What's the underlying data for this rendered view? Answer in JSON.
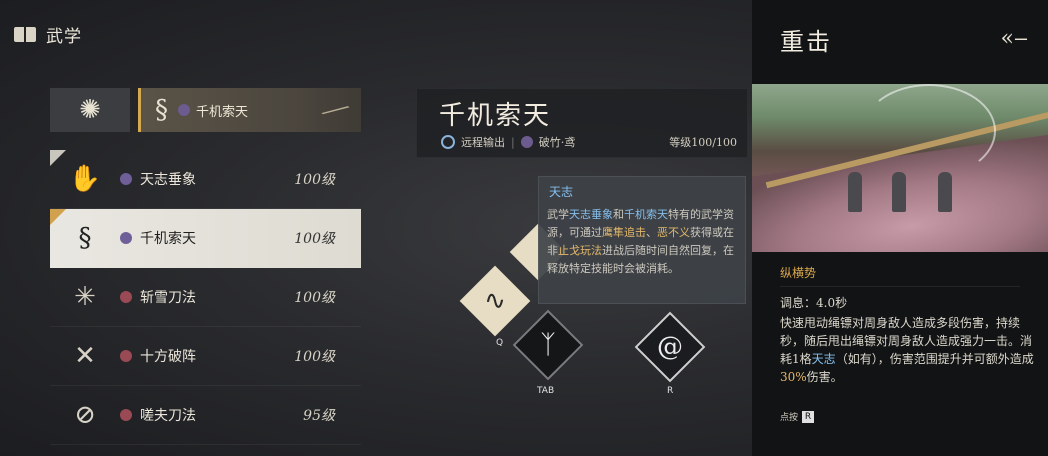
{
  "header": {
    "title": "武学"
  },
  "equipped": {
    "label": "千机索天"
  },
  "list": [
    {
      "name": "天志垂象",
      "level": "100级",
      "badge": "purple",
      "selected": false,
      "checked": true
    },
    {
      "name": "千机索天",
      "level": "100级",
      "badge": "purple",
      "selected": true,
      "checked": true
    },
    {
      "name": "斩雪刀法",
      "level": "100级",
      "badge": "red",
      "selected": false,
      "checked": false
    },
    {
      "name": "十方破阵",
      "level": "100级",
      "badge": "red",
      "selected": false,
      "checked": false
    },
    {
      "name": "嗟夫刀法",
      "level": "95级",
      "badge": "red",
      "selected": false,
      "checked": false
    }
  ],
  "card": {
    "title": "千机索天",
    "tag1": "远程输出",
    "tag2": "破竹·鸢",
    "level": "等级100/100"
  },
  "tooltip": {
    "title": "天志",
    "p1": "武学",
    "h1": "天志垂象",
    "p2": "和",
    "h2": "千机索天",
    "p3": "特有的武学资源，可通过",
    "h3": "鹰隼追击",
    "p4": "、",
    "h4": "恶不义",
    "p5": "获得或在非",
    "h5": "止戈玩法",
    "p6": "进战后随时间自然回复，在释放特定技能时会被消耗。"
  },
  "skills": {
    "q_key": "Q",
    "tab_key": "TAB",
    "r_key": "R"
  },
  "panel": {
    "title": "重击",
    "subtitle": "纵横势",
    "cooldown": "调息：4.0秒",
    "desc1": "快速甩动绳镖对周身敌人造成多段伤害，持续",
    "desc2": "秒，随后甩出绳镖对周身敌人造成强力一击。消耗",
    "desc_num": "1",
    "desc3": "格",
    "desc_hl": "天志",
    "desc4": "（如有），伤害范围提升并可额外造成",
    "desc_pct": "30%",
    "desc5": "伤害。",
    "hint": "点按",
    "hint_key": "R"
  },
  "colors": {
    "accent_gold": "#d9a84d",
    "accent_blue": "#86c0ee",
    "panel_bg": "#121315"
  }
}
